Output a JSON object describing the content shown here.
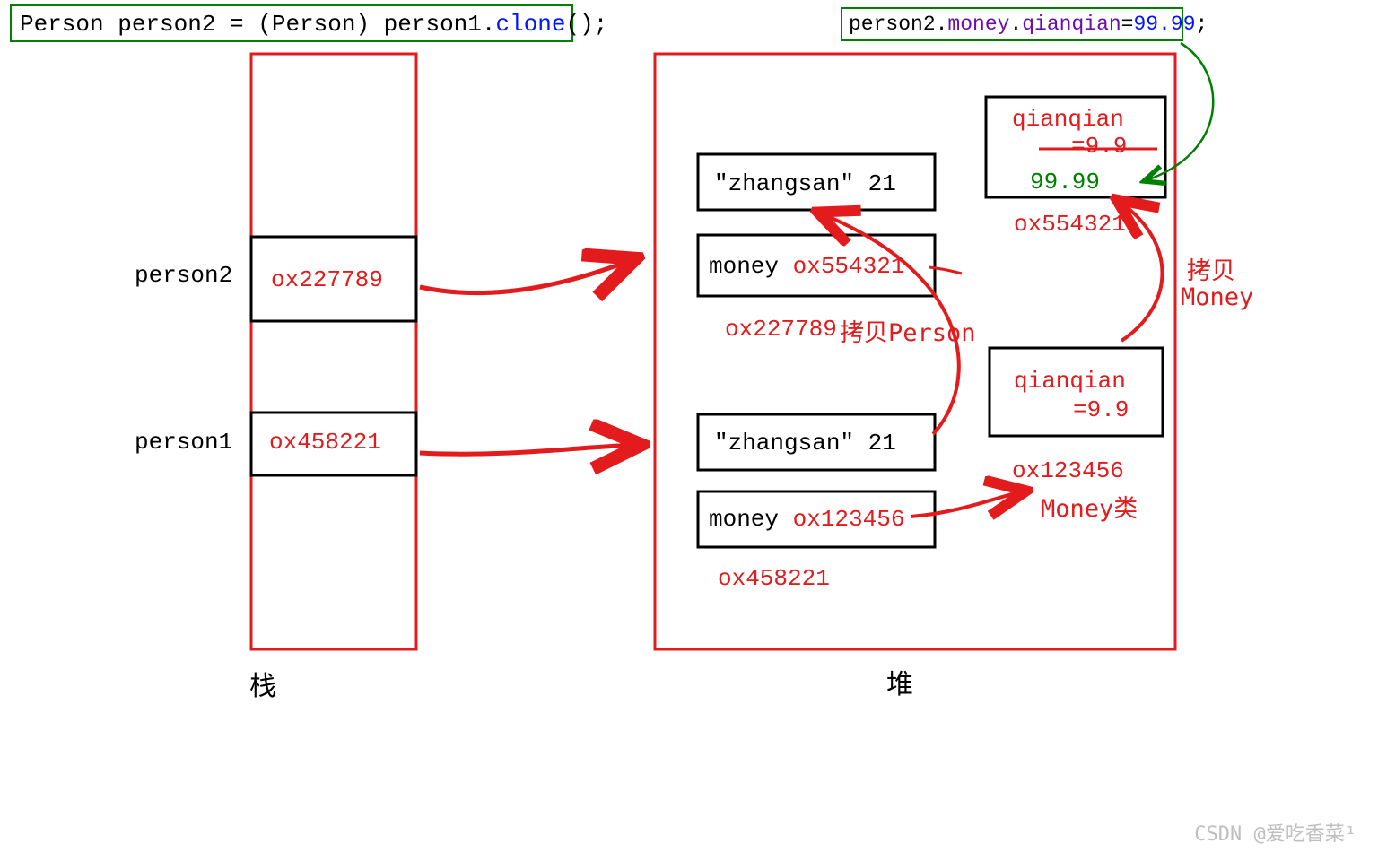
{
  "codeLeft": {
    "t1": "Person person2 = (Person) person1.",
    "t2": "clone",
    "t3": "();"
  },
  "codeRight": {
    "a": "person2.",
    "b": "money",
    "c": ".",
    "d": "qianqian",
    "e": "=",
    "f": "99.99",
    "g": ";"
  },
  "stack": {
    "label": "栈",
    "person1": {
      "name": "person1",
      "addr": "ox458221"
    },
    "person2": {
      "name": "person2",
      "addr": "ox227789"
    }
  },
  "heap": {
    "label": "堆",
    "p2": {
      "line1a": "\"zhangsan\" ",
      "line1b": "21",
      "line2a": "money ",
      "line2b": "ox554321",
      "addr": "ox227789",
      "note": "拷贝Person"
    },
    "p1": {
      "line1a": "\"zhangsan\" ",
      "line1b": "21",
      "line2a": "money ",
      "line2b": "ox123456",
      "addr": "ox458221"
    },
    "m1": {
      "field": "qianqian",
      "val": "=9.9",
      "addr": "ox123456",
      "note": "Money类"
    },
    "m2": {
      "field": "qianqian",
      "val": "=9.9",
      "newval": "99.99",
      "addr": "ox554321",
      "note": "拷贝",
      "note2": "Money"
    }
  },
  "watermark": "CSDN @爱吃香菜¹"
}
